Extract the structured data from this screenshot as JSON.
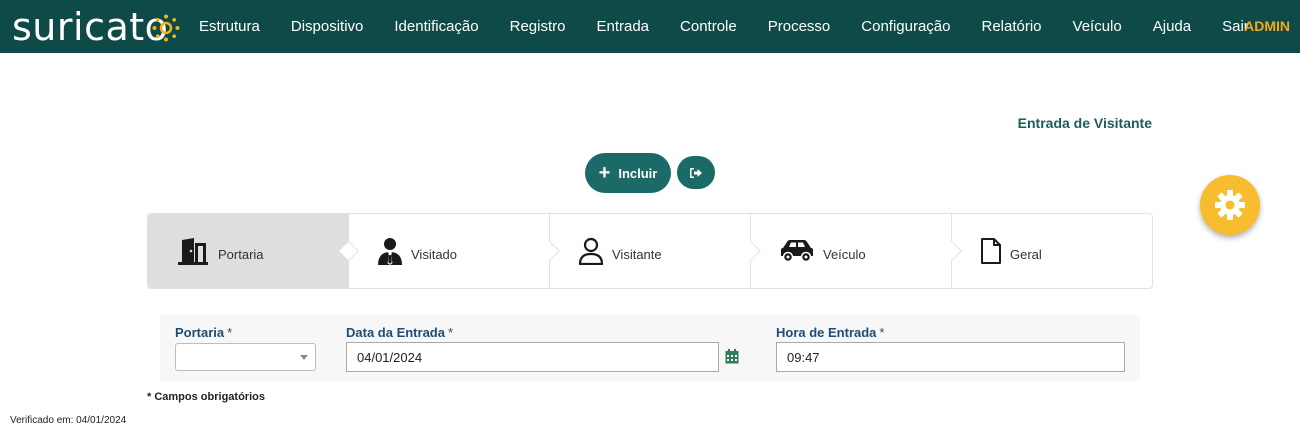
{
  "brand": {
    "name": "suricato"
  },
  "nav": {
    "items": [
      {
        "label": "Estrutura"
      },
      {
        "label": "Dispositivo"
      },
      {
        "label": "Identificação"
      },
      {
        "label": "Registro"
      },
      {
        "label": "Entrada"
      },
      {
        "label": "Controle"
      },
      {
        "label": "Processo"
      },
      {
        "label": "Configuração"
      },
      {
        "label": "Relatório"
      },
      {
        "label": "Veículo"
      },
      {
        "label": "Ajuda"
      },
      {
        "label": "Sair"
      }
    ],
    "user": "ADMIN"
  },
  "page": {
    "title": "Entrada de Visitante"
  },
  "actions": {
    "include_label": "Incluir",
    "include_icon": "plus-icon",
    "exit_icon": "sign-out-icon"
  },
  "steps": [
    {
      "label": "Portaria",
      "icon": "door-icon",
      "active": true
    },
    {
      "label": "Visitado",
      "icon": "user-tie-icon",
      "active": false
    },
    {
      "label": "Visitante",
      "icon": "user-outline-icon",
      "active": false
    },
    {
      "label": "Veículo",
      "icon": "car-icon",
      "active": false
    },
    {
      "label": "Geral",
      "icon": "file-icon",
      "active": false
    }
  ],
  "form": {
    "portaria": {
      "label": "Portaria",
      "required_mark": "*",
      "value": ""
    },
    "data_entrada": {
      "label": "Data da Entrada",
      "required_mark": "*",
      "value": "04/01/2024"
    },
    "hora_entrada": {
      "label": "Hora de Entrada",
      "required_mark": "*",
      "value": "09:47"
    }
  },
  "footer": {
    "required_note": "* Campos obrigatórios",
    "verified": "Verificado em: 04/01/2024"
  },
  "colors": {
    "topbar": "#0e4b48",
    "accent": "#1b6a67",
    "user": "#f5a623",
    "fab": "#f7bd2e",
    "label": "#1d4d78"
  }
}
